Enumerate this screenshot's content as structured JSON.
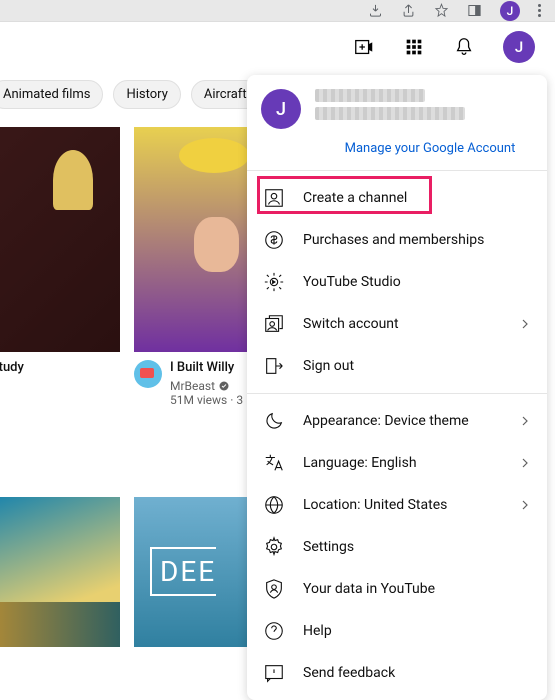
{
  "browser": {
    "avatar_letter": "J"
  },
  "header": {
    "avatar_letter": "J"
  },
  "chips": [
    "Animated films",
    "History",
    "Aircraft"
  ],
  "videos": {
    "v1": {
      "title": "lax/study"
    },
    "v2": {
      "title": "I Built Willy",
      "channel": "MrBeast",
      "stats": "51M views · 3"
    }
  },
  "deep_label": "DEE",
  "account_menu": {
    "avatar_letter": "J",
    "manage": "Manage your Google Account",
    "items": {
      "create_channel": "Create a channel",
      "purchases": "Purchases and memberships",
      "studio": "YouTube Studio",
      "switch": "Switch account",
      "signout": "Sign out",
      "appearance": "Appearance: Device theme",
      "language": "Language: English",
      "location": "Location: United States",
      "settings": "Settings",
      "your_data": "Your data in YouTube",
      "help": "Help",
      "feedback": "Send feedback"
    }
  }
}
